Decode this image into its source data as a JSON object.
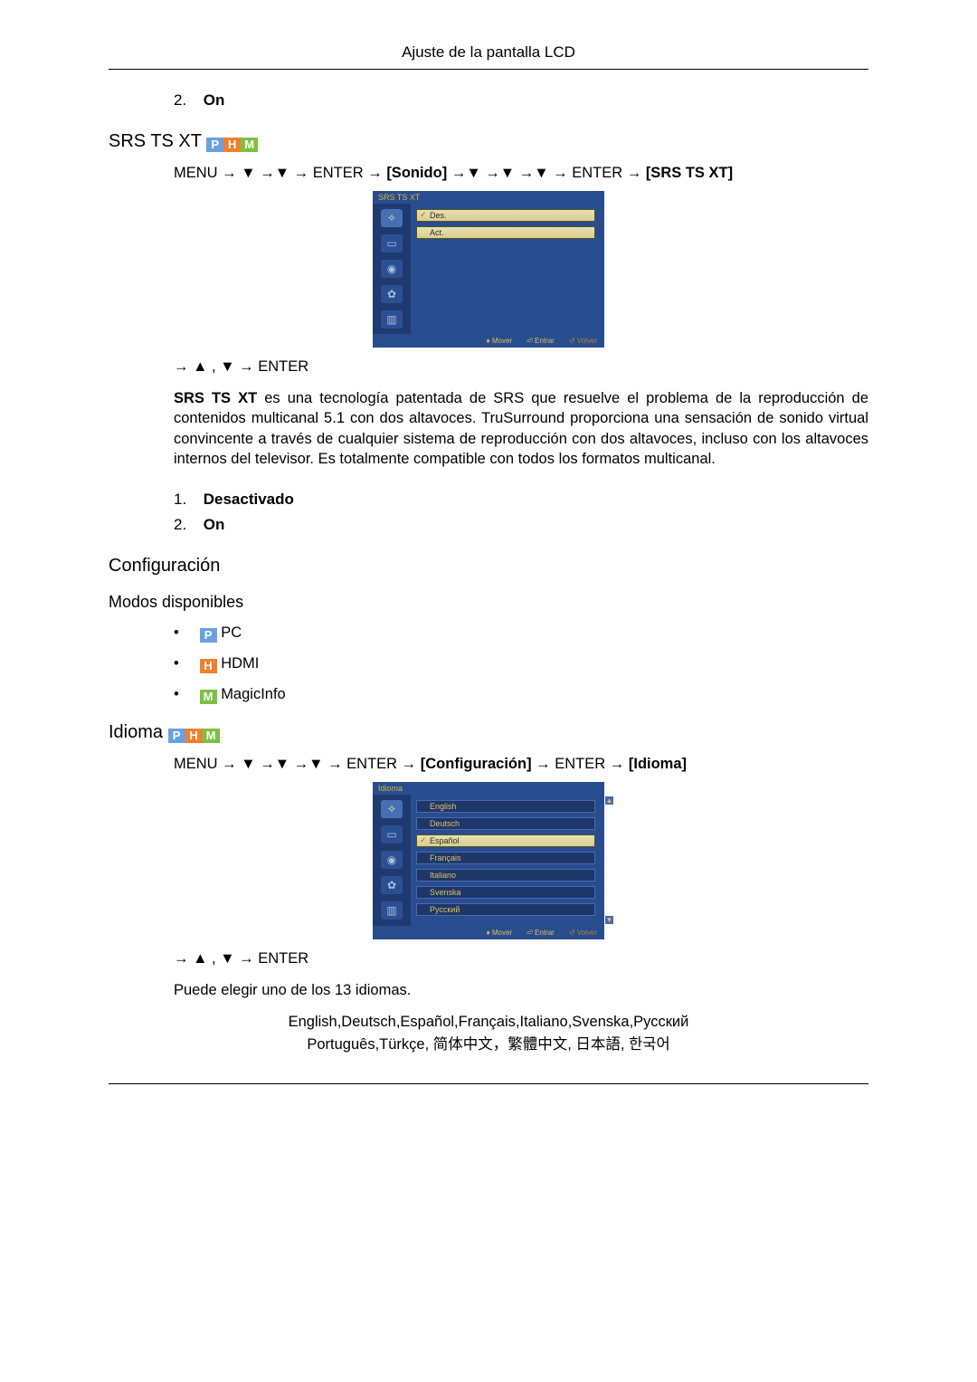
{
  "header": {
    "title": "Ajuste de la pantalla LCD"
  },
  "intro_list": {
    "items": [
      {
        "num": "2.",
        "label": "On"
      }
    ]
  },
  "srs": {
    "heading": "SRS TS XT",
    "nav_parts": {
      "p0": "MENU → ",
      "p1": " →",
      "p2": " → ENTER → ",
      "p3": "[Sonido]",
      "p4": " →",
      "p5": "→",
      "p6": "→",
      "p7": "→ ENTER → ",
      "p8": "[SRS TS XT]"
    },
    "osd": {
      "title": "SRS TS XT",
      "opts": [
        "Des.",
        "Act."
      ],
      "selected_index": 0,
      "footer": {
        "mover": "Mover",
        "entrar": "Entrar",
        "volver": "Volver"
      }
    },
    "nav2": {
      "p0": "→ ",
      "p1": " , ",
      "p2": " → ENTER"
    },
    "desc_lead": "SRS TS XT",
    "desc": " es una tecnología patentada de SRS que resuelve el problema de la reproducción de contenidos multicanal 5.1 con dos altavoces. TruSurround proporciona una sensación de sonido virtual convincente a través de cualquier sistema de reproducción con dos altavoces, incluso con los altavoces internos del televisor. Es totalmente compatible con todos los formatos multicanal.",
    "options": [
      {
        "num": "1.",
        "label": "Desactivado"
      },
      {
        "num": "2.",
        "label": "On"
      }
    ]
  },
  "config": {
    "heading": "Configuración",
    "modes_heading": "Modos disponibles",
    "modes": [
      {
        "icon": "P",
        "cls": "mi-p",
        "label": "PC"
      },
      {
        "icon": "H",
        "cls": "mi-h",
        "label": "HDMI"
      },
      {
        "icon": "M",
        "cls": "mi-m",
        "label": "MagicInfo"
      }
    ]
  },
  "idioma": {
    "heading": "Idioma",
    "nav_parts": {
      "p0": "MENU → ",
      "p1": " →",
      "p2": " →",
      "p3": " → ENTER → ",
      "p4": "[Configuración]",
      "p5": " → ENTER → ",
      "p6": "[Idioma]"
    },
    "osd": {
      "title": "Idioma",
      "opts": [
        "English",
        "Deutsch",
        "Español",
        "Français",
        "Italiano",
        "Svenska",
        "Русский"
      ],
      "selected_index": 2,
      "footer": {
        "mover": "Mover",
        "entrar": "Entrar",
        "volver": "Volver"
      }
    },
    "nav2": {
      "p0": "→ ",
      "p1": " , ",
      "p2": " → ENTER"
    },
    "desc": "Puede elegir uno de los 13 idiomas.",
    "langs_line1": "English,Deutsch,Español,Français,Italiano,Svenska,Русский",
    "langs_line2": "Português,Türkçe, 简体中文，繁體中文, 日本語, 한국어"
  },
  "glyphs": {
    "down": "▼",
    "up": "▲"
  }
}
